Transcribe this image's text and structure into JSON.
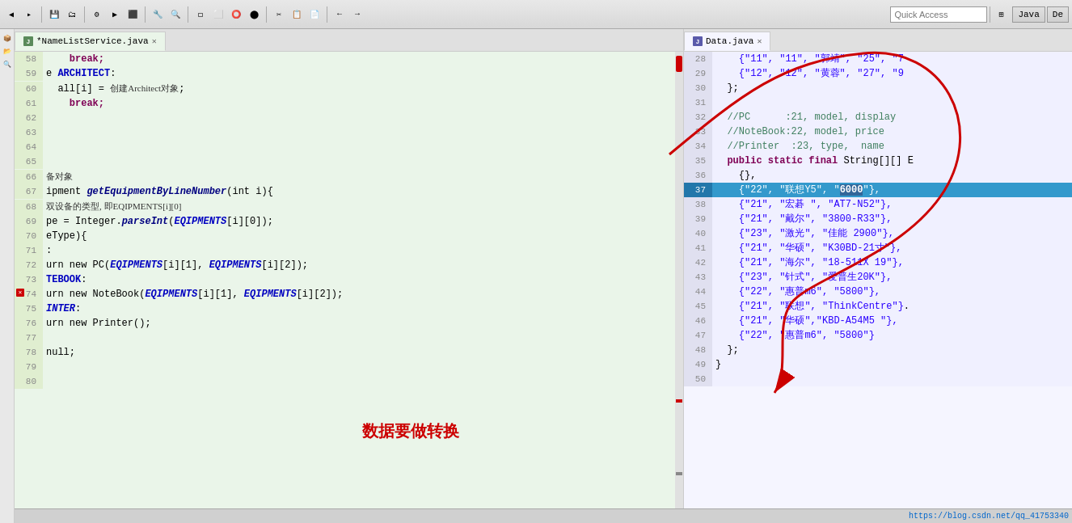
{
  "toolbar": {
    "quick_access_placeholder": "Quick Access",
    "quick_access_value": "",
    "java_label": "Java",
    "perspective_label": "De"
  },
  "left_pane": {
    "tab_label": "*NameListService.java",
    "tab_modified": true,
    "lines": [
      {
        "num": 58,
        "tokens": [
          {
            "t": "    break;",
            "c": "kw"
          }
        ]
      },
      {
        "num": 59,
        "tokens": [
          {
            "t": "e ",
            "c": ""
          },
          {
            "t": "ARCHITECT",
            "c": "kw2"
          },
          {
            "t": ":",
            "c": ""
          }
        ]
      },
      {
        "num": 60,
        "tokens": [
          {
            "t": "  all[i] = ",
            "c": ""
          },
          {
            "t": "创建Architect对象",
            "c": "chinese"
          },
          {
            "t": ";",
            "c": ""
          }
        ]
      },
      {
        "num": 61,
        "tokens": [
          {
            "t": "    break;",
            "c": "kw"
          }
        ]
      },
      {
        "num": 62,
        "tokens": []
      },
      {
        "num": 63,
        "tokens": []
      },
      {
        "num": 64,
        "tokens": []
      },
      {
        "num": 65,
        "tokens": []
      },
      {
        "num": 66,
        "tokens": [
          {
            "t": "备对象",
            "c": "chinese"
          }
        ]
      },
      {
        "num": 67,
        "tokens": [
          {
            "t": "ipment getEquipmentByLineNumber(int i){",
            "c": ""
          }
        ]
      },
      {
        "num": 68,
        "tokens": [
          {
            "t": "双设备的类型, 即EQIPMENTS[i][0]",
            "c": "chinese"
          }
        ]
      },
      {
        "num": 69,
        "tokens": [
          {
            "t": "pe = Integer.",
            "c": ""
          },
          {
            "t": "parseInt",
            "c": "method"
          },
          {
            "t": "(",
            "c": ""
          },
          {
            "t": "EQIPMENTS",
            "c": "italic-blue"
          },
          {
            "t": "[i][0]);",
            "c": ""
          }
        ]
      },
      {
        "num": 70,
        "tokens": [
          {
            "t": "eType){",
            "c": ""
          }
        ]
      },
      {
        "num": 71,
        "tokens": [
          {
            "t": ":",
            "c": ""
          }
        ]
      },
      {
        "num": 72,
        "tokens": [
          {
            "t": "urn new PC(",
            "c": ""
          },
          {
            "t": "EQIPMENTS",
            "c": "italic-blue"
          },
          {
            "t": "[i][1], ",
            "c": ""
          },
          {
            "t": "EQIPMENTS",
            "c": "italic-blue"
          },
          {
            "t": "[i][2]);",
            "c": ""
          }
        ]
      },
      {
        "num": 73,
        "tokens": [
          {
            "t": "TEBOOK",
            "c": "kw2"
          },
          {
            "t": ":",
            "c": ""
          }
        ]
      },
      {
        "num": 74,
        "tokens": [
          {
            "t": "urn new NoteBook(",
            "c": ""
          },
          {
            "t": "EQIPMENTS",
            "c": "italic-blue"
          },
          {
            "t": "[i][1], ",
            "c": ""
          },
          {
            "t": "EQIPMENTS",
            "c": "italic-blue"
          },
          {
            "t": "[i][2]);",
            "c": ""
          }
        ],
        "has_error": true
      },
      {
        "num": 75,
        "tokens": [
          {
            "t": "INTER",
            "c": "kw2"
          },
          {
            "t": ":",
            "c": ""
          }
        ]
      },
      {
        "num": 76,
        "tokens": [
          {
            "t": "urn new Printer();",
            "c": ""
          }
        ]
      },
      {
        "num": 77,
        "tokens": []
      },
      {
        "num": 78,
        "tokens": [
          {
            "t": "null;",
            "c": ""
          }
        ]
      },
      {
        "num": 79,
        "tokens": []
      },
      {
        "num": 80,
        "tokens": []
      }
    ],
    "note_text": "数据要做转换"
  },
  "right_pane": {
    "tab_label": "Data.java",
    "lines": [
      {
        "num": 28,
        "tokens": [
          {
            "t": "    {\"11\", \"11\", \"郭靖\", \"25\", \"7",
            "c": "str"
          }
        ]
      },
      {
        "num": 29,
        "tokens": [
          {
            "t": "    {\"12\", \"12\", \"黄蓉\", \"27\", \"9",
            "c": "str"
          }
        ]
      },
      {
        "num": 30,
        "tokens": [
          {
            "t": "  };",
            "c": ""
          }
        ]
      },
      {
        "num": 31,
        "tokens": []
      },
      {
        "num": 32,
        "tokens": [
          {
            "t": "  ",
            "c": ""
          },
          {
            "t": "//PC      :21, model, display",
            "c": "comment"
          }
        ]
      },
      {
        "num": 33,
        "tokens": [
          {
            "t": "  ",
            "c": ""
          },
          {
            "t": "//NoteBook:22, model, price",
            "c": "comment"
          }
        ]
      },
      {
        "num": 34,
        "tokens": [
          {
            "t": "  ",
            "c": ""
          },
          {
            "t": "//Printer  :23, type,  name",
            "c": "comment"
          }
        ]
      },
      {
        "num": 35,
        "tokens": [
          {
            "t": "  ",
            "c": ""
          },
          {
            "t": "public",
            "c": "kw"
          },
          {
            "t": " ",
            "c": ""
          },
          {
            "t": "static",
            "c": "kw"
          },
          {
            "t": " ",
            "c": ""
          },
          {
            "t": "final",
            "c": "kw"
          },
          {
            "t": " String[][] E",
            "c": ""
          }
        ]
      },
      {
        "num": 36,
        "tokens": [
          {
            "t": "    {},",
            "c": ""
          }
        ]
      },
      {
        "num": 37,
        "tokens": [
          {
            "t": "    {\"22\", \"联想Y5\", \"",
            "c": "str"
          },
          {
            "t": "6000",
            "c": "highlight-sel"
          },
          {
            "t": "\"},",
            "c": "str"
          }
        ],
        "selected": true
      },
      {
        "num": 38,
        "tokens": [
          {
            "t": "    {\"21\", \"宏碁 \", \"AT7-N52\"},",
            "c": "str"
          }
        ]
      },
      {
        "num": 39,
        "tokens": [
          {
            "t": "    {\"21\", \"戴尔\", \"3800-R33\"},",
            "c": "str"
          }
        ]
      },
      {
        "num": 40,
        "tokens": [
          {
            "t": "    {\"23\", \"激光\", \"佳能 2900\"},",
            "c": "str"
          }
        ]
      },
      {
        "num": 41,
        "tokens": [
          {
            "t": "    {\"21\", \"华硕\", \"K30BD-21寸\"},",
            "c": "str"
          }
        ]
      },
      {
        "num": 42,
        "tokens": [
          {
            "t": "    {\"21\", \"海尔\", \"18-511X 19\"},",
            "c": "str"
          }
        ]
      },
      {
        "num": 43,
        "tokens": [
          {
            "t": "    {\"23\", \"针式\", \"爱普生20K\"},",
            "c": "str"
          }
        ]
      },
      {
        "num": 44,
        "tokens": [
          {
            "t": "    {\"22\", \"惠普m6\", \"5800\"},",
            "c": "str"
          }
        ]
      },
      {
        "num": 45,
        "tokens": [
          {
            "t": "    {\"21\", \"联想\", \"ThinkCentre\"}",
            "c": "str"
          },
          {
            "t": ".",
            "c": ""
          }
        ]
      },
      {
        "num": 46,
        "tokens": [
          {
            "t": "    {\"21\", \"华硕\",\"KBD-A54M5 \"},",
            "c": "str"
          }
        ]
      },
      {
        "num": 47,
        "tokens": [
          {
            "t": "    {\"22\", \"惠普m6\", \"5800\"}",
            "c": "str"
          }
        ]
      },
      {
        "num": 48,
        "tokens": [
          {
            "t": "  };",
            "c": ""
          }
        ]
      },
      {
        "num": 49,
        "tokens": [
          {
            "t": "}",
            "c": ""
          }
        ]
      },
      {
        "num": 50,
        "tokens": []
      }
    ]
  },
  "status_bar": {
    "url": "https://blog.csdn.net/qq_41753340"
  }
}
